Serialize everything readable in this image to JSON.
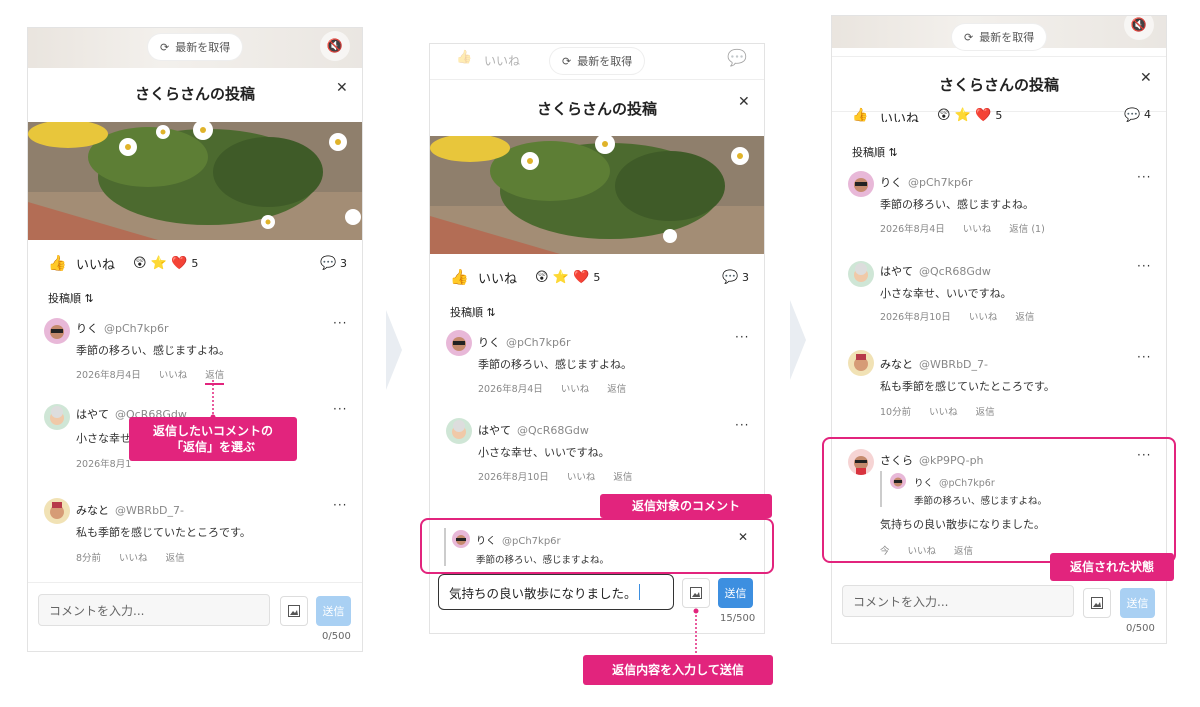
{
  "post": {
    "title": "さくらさんの投稿",
    "like_label": "いいね",
    "reactions": [
      "😲",
      "⭐",
      "❤️"
    ],
    "reaction_count": "5",
    "comment_count": "3",
    "sort_label": "投稿順",
    "sort_icon": "⇅",
    "refresh_label": "最新を取得",
    "close_icon": "✕"
  },
  "comments": [
    {
      "name": "りく",
      "handle": "@pCh7kp6r",
      "text": "季節の移ろい、感じますよね。",
      "date": "2026年8月4日",
      "like": "いいね",
      "reply": "返信",
      "reply_count": "(1)"
    },
    {
      "name": "はやて",
      "handle": "@QcR68Gdw",
      "text": "小さな幸せ、いいですね。",
      "date": "2026年8月10日",
      "like": "いいね",
      "reply": "返信"
    },
    {
      "name": "みなと",
      "handle": "@WBRbD_7-",
      "text": "私も季節を感じていたところです。",
      "date_panel1": "8分前",
      "date_panel3": "10分前",
      "like": "いいね",
      "reply": "返信"
    },
    {
      "name": "さくら",
      "handle": "@kP9PQ-ph",
      "text": "気持ちの良い散歩になりました。",
      "date": "今",
      "like": "いいね",
      "reply": "返信"
    }
  ],
  "panel1": {
    "input_placeholder": "コメントを入力...",
    "send_label": "送信",
    "counter": "0/500",
    "handle_cut": "@QcR68Gdw",
    "text_cut": "小さな幸せ",
    "date_cut": "2026年8月1"
  },
  "panel2": {
    "input_value": "気持ちの良い散歩になりました。",
    "send_label": "送信",
    "counter": "15/500"
  },
  "panel3": {
    "input_placeholder": "コメントを入力...",
    "send_label": "送信",
    "counter": "0/500",
    "peek_count": "4"
  },
  "callouts": {
    "choose_reply": "返信したいコメントの\n「返信」を選ぶ",
    "target_comment": "返信対象のコメント",
    "input_and_send": "返信内容を入力して送信",
    "replied_state": "返信された状態"
  },
  "colors": {
    "accent": "#e2247d",
    "send_active": "#3d8fe0",
    "send_disabled": "#a9d0f3"
  }
}
